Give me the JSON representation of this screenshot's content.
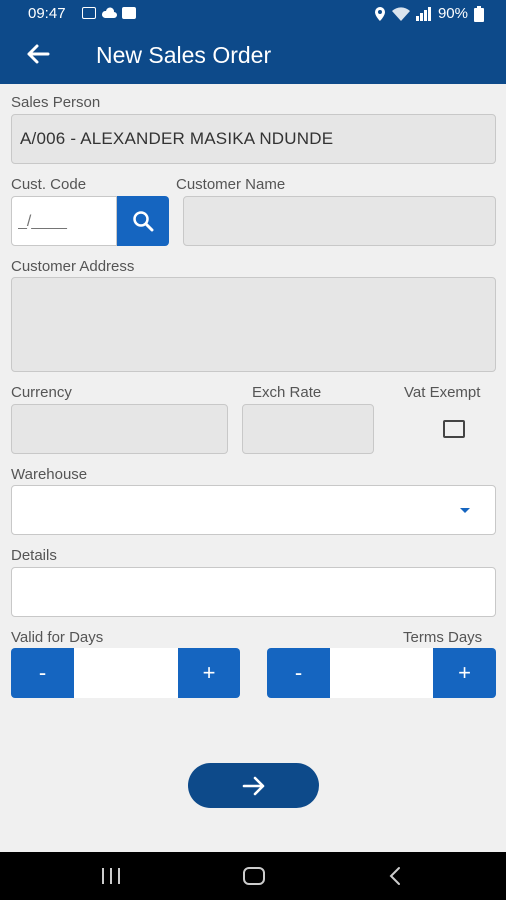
{
  "status_bar": {
    "time": "09:47",
    "battery": "90%"
  },
  "header": {
    "title": "New Sales Order"
  },
  "form": {
    "sales_person": {
      "label": "Sales Person",
      "value": "A/006 - ALEXANDER MASIKA NDUNDE"
    },
    "cust_code": {
      "label": "Cust. Code",
      "placeholder": "_/____"
    },
    "customer_name": {
      "label": "Customer Name",
      "value": ""
    },
    "customer_address": {
      "label": "Customer Address",
      "value": ""
    },
    "currency": {
      "label": "Currency",
      "value": ""
    },
    "exch_rate": {
      "label": "Exch Rate",
      "value": ""
    },
    "vat_exempt": {
      "label": "Vat Exempt",
      "checked": false
    },
    "warehouse": {
      "label": "Warehouse",
      "value": ""
    },
    "details": {
      "label": "Details",
      "value": ""
    },
    "valid_for_days": {
      "label": "Valid for Days",
      "minus": "-",
      "plus": "+",
      "value": ""
    },
    "terms_days": {
      "label": "Terms Days",
      "minus": "-",
      "plus": "+",
      "value": ""
    }
  },
  "colors": {
    "primary_dark": "#0d4a8a",
    "primary": "#1565c0"
  },
  "icons": {
    "back": "arrow-left-icon",
    "search": "search-icon",
    "dropdown": "chevron-down-icon",
    "next": "arrow-right-icon"
  }
}
